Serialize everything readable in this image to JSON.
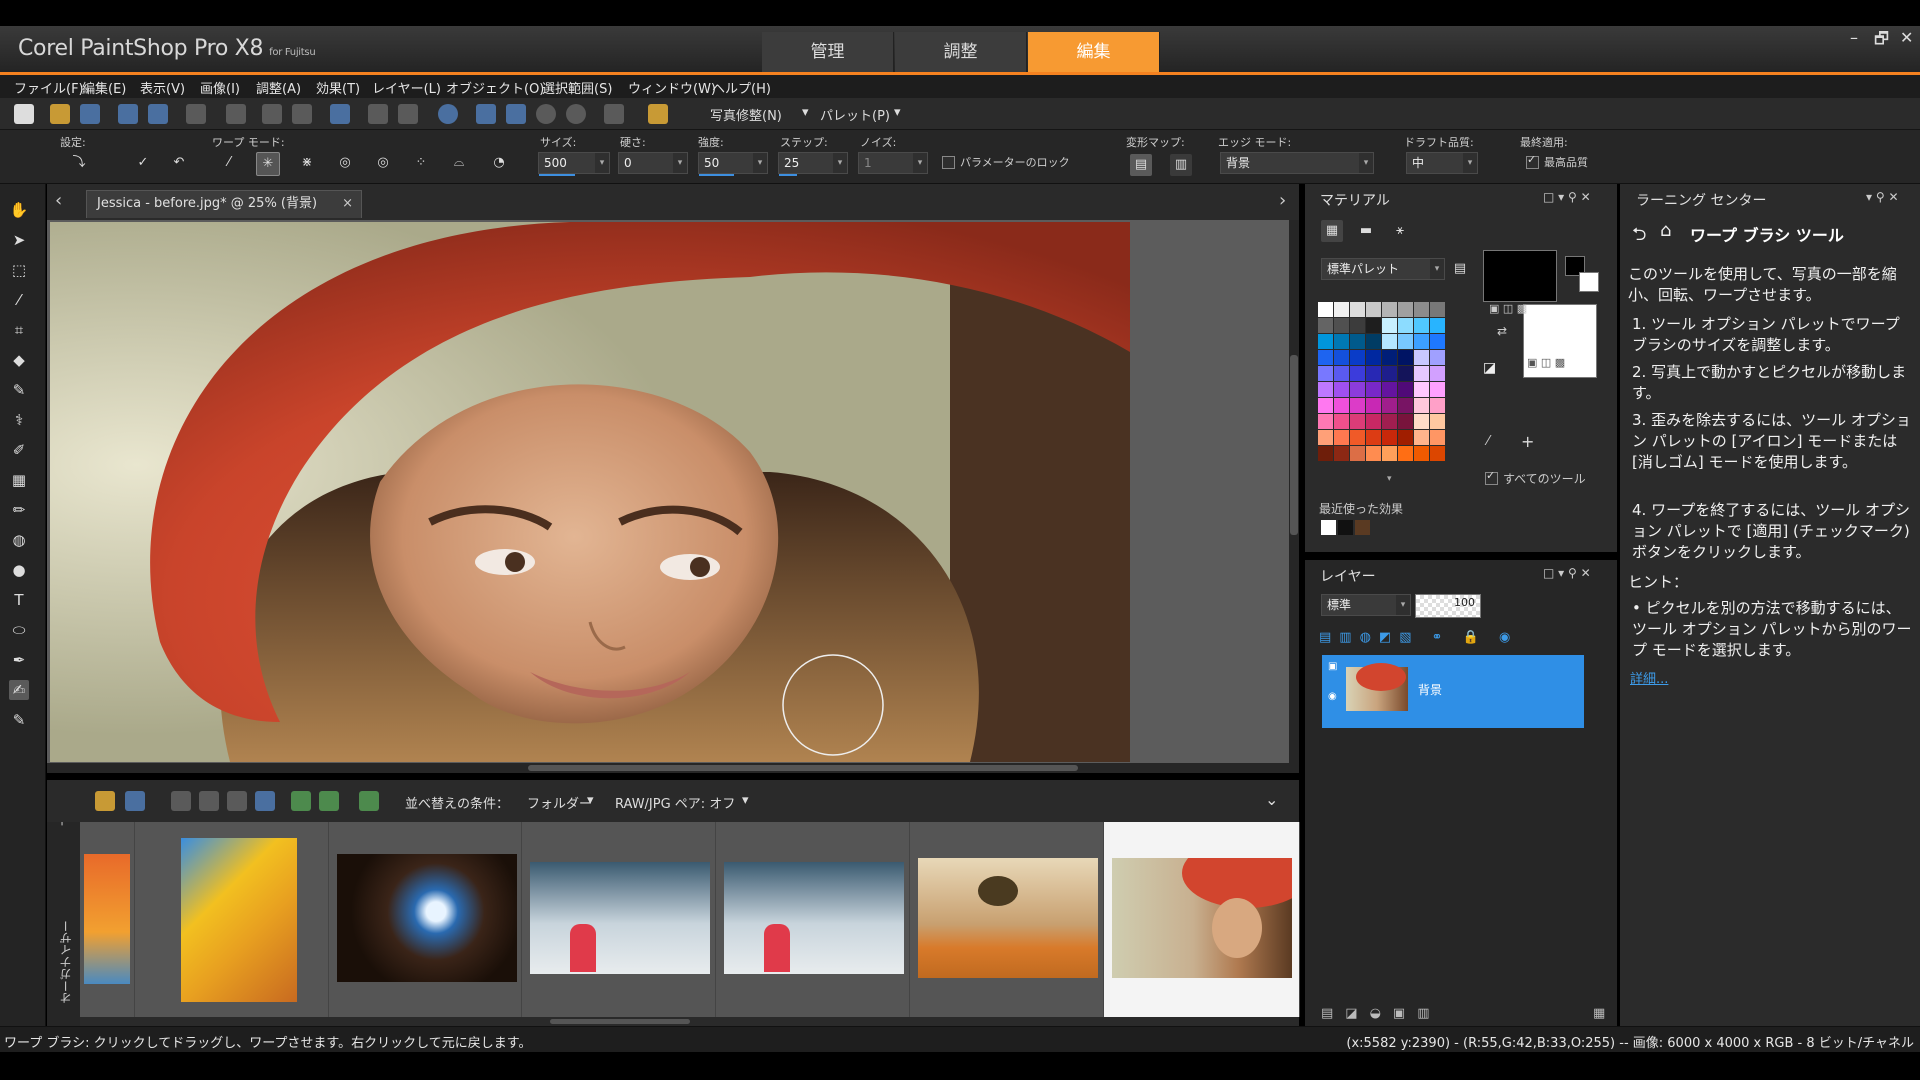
{
  "app": {
    "logo": "Corel PaintShop Pro X8",
    "logo_sub": "for Fujitsu",
    "tabs": [
      "管理",
      "調整",
      "編集"
    ],
    "active_tab": "編集",
    "window_controls": [
      "–",
      "🗗",
      "✕"
    ]
  },
  "menu": [
    "ファイル(F)",
    "編集(E)",
    "表示(V)",
    "画像(I)",
    "調整(A)",
    "効果(T)",
    "レイヤー(L)",
    "オブジェクト(O)",
    "選択範囲(S)",
    "ウィンドウ(W)",
    "ヘルプ(H)"
  ],
  "toolbar": {
    "photo_fix_label": "写真修整(N)",
    "palette_label": "パレット(P)"
  },
  "options": {
    "settings_label": "設定:",
    "warp_mode_label": "ワープ モード:",
    "size_label": "サイズ:",
    "size_value": "500",
    "hardness_label": "硬さ:",
    "hardness_value": "0",
    "strength_label": "強度:",
    "strength_value": "50",
    "step_label": "ステップ:",
    "step_value": "25",
    "noise_label": "ノイズ:",
    "noise_value": "1",
    "lock_params_label": "パラメーターのロック",
    "deform_map_label": "変形マップ:",
    "edge_mode_label": "エッジ モード:",
    "edge_mode_value": "背景",
    "draft_quality_label": "ドラフト品質:",
    "draft_quality_value": "中",
    "final_apply_label": "最終適用:",
    "final_apply_value": "最高品質"
  },
  "document": {
    "tab_title": "Jessica - before.jpg* @  25% (背景)",
    "close": "×",
    "nav_left": "‹",
    "nav_right": "›"
  },
  "organizer": {
    "sort_label": "並べ替えの条件：",
    "sort_value": "フォルダー",
    "raw_jpg_label": "RAW/JPG ペア: オフ",
    "side_label": "オーガナイザー",
    "thumb_count": 7,
    "selected_index": 6
  },
  "materials": {
    "title": "マテリアル",
    "palette_select": "標準パレット",
    "all_tools_label": "すべてのツール",
    "recent_label": "最近使った効果",
    "swatches": [
      [
        "#ffffff",
        "#f0f0f0",
        "#dcdcdc",
        "#c8c8c8",
        "#b4b4b4",
        "#a0a0a0",
        "#8c8c8c",
        "#787878"
      ],
      [
        "#646464",
        "#505050",
        "#3c3c3c",
        "#1e1e1e",
        "#c8f0ff",
        "#8cdcff",
        "#50c8ff",
        "#28b4ff"
      ],
      [
        "#0096dc",
        "#0078b4",
        "#005a8c",
        "#003c64",
        "#b4e6ff",
        "#78c8ff",
        "#3ca0ff",
        "#1e78ff"
      ],
      [
        "#1e64f0",
        "#1450dc",
        "#0a3cc8",
        "#0028a0",
        "#001e78",
        "#001464",
        "#c8c8ff",
        "#a0a0ff"
      ],
      [
        "#7878ff",
        "#5a5af0",
        "#3c3cdc",
        "#2828b4",
        "#1e1e8c",
        "#14145a",
        "#e6c8ff",
        "#d2a0ff"
      ],
      [
        "#be78ff",
        "#a050f0",
        "#8c3cdc",
        "#7828c8",
        "#6414a0",
        "#500a78",
        "#ffc8ff",
        "#ffa0ff"
      ],
      [
        "#ff78f0",
        "#f050dc",
        "#dc3cc8",
        "#c828b4",
        "#a01e8c",
        "#781464",
        "#ffc8dc",
        "#ffa0c8"
      ],
      [
        "#ff78b4",
        "#f0508c",
        "#dc3c78",
        "#c82864",
        "#a01e50",
        "#78143c",
        "#ffdcc8",
        "#ffc8a0"
      ],
      [
        "#ffa078",
        "#ff7850",
        "#f05a28",
        "#dc3c14",
        "#c8280a",
        "#a01e00",
        "#ffb48c",
        "#ff9664"
      ],
      [
        "#6e1e0a",
        "#8c2814",
        "#dc6e46",
        "#ff8c50",
        "#ffa05a",
        "#ff6e14",
        "#f05a00",
        "#dc4600"
      ]
    ],
    "recent_swatches": [
      "#ffffff",
      "#111111",
      "#5a3a22"
    ]
  },
  "layers": {
    "title": "レイヤー",
    "blend_mode": "標準",
    "opacity": "100",
    "layer_name": "背景"
  },
  "learning": {
    "title": "ラーニング センター",
    "tool_title": "ワープ ブラシ ツール",
    "intro": "このツールを使用して、写真の一部を縮小、回転、ワープさせます。",
    "steps": [
      "ツール オプション パレットでワープ ブラシのサイズを調整します。",
      "写真上で動かすとピクセルが移動します。",
      "歪みを除去するには、ツール オプション パレットの [アイロン] モードまたは [消しゴム] モードを使用します。",
      "ワープを終了するには、ツール オプション パレットで [適用] (チェックマーク) ボタンをクリックします。"
    ],
    "hint_label": "ヒント：",
    "hint": "ピクセルを別の方法で移動するには、ツール オプション パレットから別のワープ モードを選択します。",
    "more_link": "詳細..."
  },
  "status": {
    "left": "ワープ ブラシ: クリックしてドラッグし、ワープさせます。右クリックして元に戻します。",
    "right": "(x:5582 y:2390) - (R:55,G:42,B:33,O:255) -- 画像:  6000 x 4000 x RGB - 8 ビット/チャネル"
  },
  "colors": {
    "accent": "#f58220",
    "selection_blue": "#2f8fe6",
    "panel": "#2b2b2b"
  }
}
